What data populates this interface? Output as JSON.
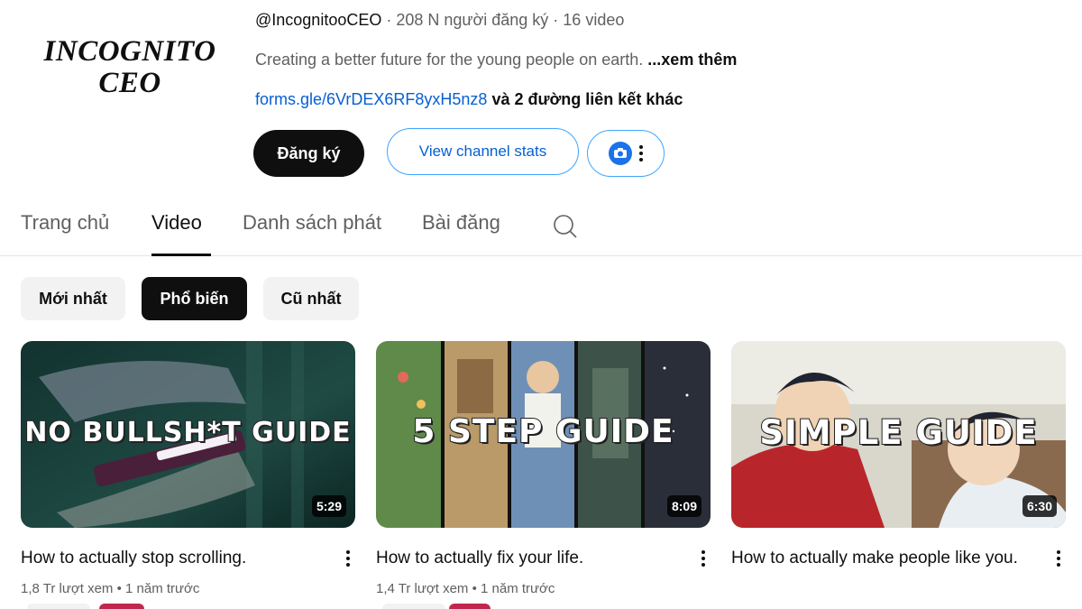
{
  "channel": {
    "logo_line1": "INCOGNITO",
    "logo_line2": "CEO",
    "handle": "@IncognitooCEO",
    "subscribers": "208 N người đăng ký",
    "videos_count": "16 video",
    "separator": " · ",
    "description": "Creating a better future for the young people on earth.",
    "more_label": "...xem thêm",
    "link_url": "forms.gle/6VrDEX6RF8yxH5nz8",
    "more_links": "và 2 đường liên kết khác"
  },
  "actions": {
    "subscribe": "Đăng ký",
    "view_stats": "View channel stats"
  },
  "tabs": [
    {
      "label": "Trang chủ",
      "active": false
    },
    {
      "label": "Video",
      "active": true
    },
    {
      "label": "Danh sách phát",
      "active": false
    },
    {
      "label": "Bài đăng",
      "active": false
    }
  ],
  "filters": [
    {
      "label": "Mới nhất",
      "active": false
    },
    {
      "label": "Phổ biến",
      "active": true
    },
    {
      "label": "Cũ nhất",
      "active": false
    }
  ],
  "videos": [
    {
      "thumb_text": "NO BULLSH*T GUIDE",
      "duration": "5:29",
      "title": "How to actually stop scrolling.",
      "views": "1,8 Tr lượt xem",
      "age": "1 năm trước"
    },
    {
      "thumb_text": "5 STEP GUIDE",
      "duration": "8:09",
      "title": "How to actually fix your life.",
      "views": "1,4 Tr lượt xem",
      "age": "1 năm trước"
    },
    {
      "thumb_text": "SIMPLE GUIDE",
      "duration": "6:30",
      "title": "How to actually make people like you.",
      "views": "",
      "age": ""
    }
  ],
  "meta_separator": " • ",
  "colors": {
    "link": "#065fd4",
    "outline": "#3ea6ff",
    "text_primary": "#0f0f0f",
    "text_secondary": "#606060",
    "chip_bg": "#f2f2f2"
  }
}
